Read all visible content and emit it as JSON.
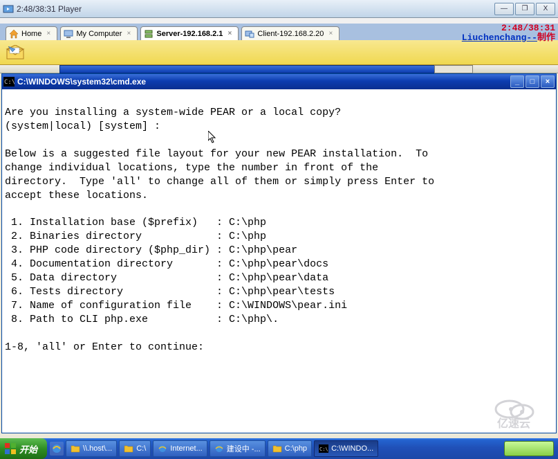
{
  "player": {
    "title": "2:48/38:31 Player",
    "controls": {
      "min": "—",
      "max": "❐",
      "close": "X"
    }
  },
  "timer_overlay": {
    "time": "2:48/38:31",
    "credit_prefix": "Liuchenchang--",
    "credit_suffix": "制作"
  },
  "tabs": [
    {
      "label": "Home",
      "icon": "home",
      "active": false
    },
    {
      "label": "My Computer",
      "icon": "computer",
      "active": false
    },
    {
      "label": "Server-192.168.2.1",
      "icon": "server",
      "active": true
    },
    {
      "label": "Client-192.168.2.20",
      "icon": "client",
      "active": false
    }
  ],
  "cmd": {
    "title": "C:\\WINDOWS\\system32\\cmd.exe",
    "controls": {
      "min": "_",
      "max": "□",
      "close": "×"
    },
    "lines": [
      "",
      "Are you installing a system-wide PEAR or a local copy?",
      "(system|local) [system] :",
      "",
      "Below is a suggested file layout for your new PEAR installation.  To",
      "change individual locations, type the number in front of the",
      "directory.  Type 'all' to change all of them or simply press Enter to",
      "accept these locations.",
      "",
      " 1. Installation base ($prefix)   : C:\\php",
      " 2. Binaries directory            : C:\\php",
      " 3. PHP code directory ($php_dir) : C:\\php\\pear",
      " 4. Documentation directory       : C:\\php\\pear\\docs",
      " 5. Data directory                : C:\\php\\pear\\data",
      " 6. Tests directory               : C:\\php\\pear\\tests",
      " 7. Name of configuration file    : C:\\WINDOWS\\pear.ini",
      " 8. Path to CLI php.exe           : C:\\php\\.",
      "",
      "1-8, 'all' or Enter to continue:"
    ]
  },
  "taskbar": {
    "start": "开始",
    "items": [
      {
        "label": "\\\\.host\\...",
        "icon": "folder"
      },
      {
        "label": "C:\\",
        "icon": "folder"
      },
      {
        "label": "Internet...",
        "icon": "ie"
      },
      {
        "label": "建设中 -...",
        "icon": "ie"
      },
      {
        "label": "C:\\php",
        "icon": "folder"
      },
      {
        "label": "C:\\WINDO...",
        "icon": "cmd",
        "active": true
      }
    ]
  },
  "watermark": "亿速云"
}
